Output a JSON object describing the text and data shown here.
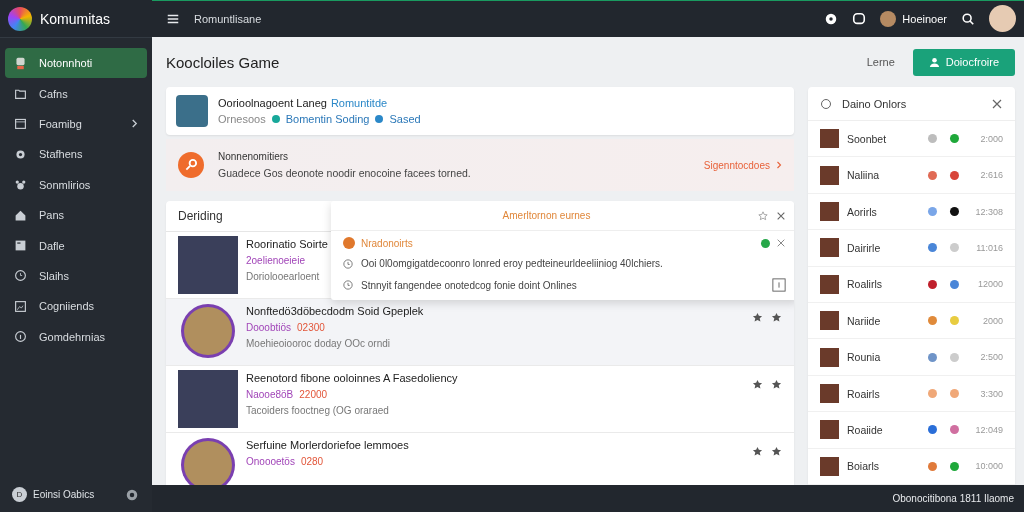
{
  "app": {
    "name": "Komumitas"
  },
  "topbar": {
    "title": "Romuntlisane",
    "user_name": "Hoeinoer"
  },
  "sidebar": {
    "items": [
      {
        "label": "Notonnhoti",
        "selected": true,
        "submenu": false
      },
      {
        "label": "Cafns",
        "selected": false,
        "submenu": false
      },
      {
        "label": "Foamibg",
        "selected": false,
        "submenu": true
      },
      {
        "label": "Stafhens",
        "selected": false,
        "submenu": false
      },
      {
        "label": "Sonmlirios",
        "selected": false,
        "submenu": false
      },
      {
        "label": "Pans",
        "selected": false,
        "submenu": false
      },
      {
        "label": "Dafle",
        "selected": false,
        "submenu": false
      },
      {
        "label": "Slaihs",
        "selected": false,
        "submenu": false
      },
      {
        "label": "Cogniiends",
        "selected": false,
        "submenu": false
      },
      {
        "label": "Gomdehrnias",
        "selected": false,
        "submenu": false
      }
    ],
    "footer": {
      "initial": "D",
      "label": "Eoinsi Oabics"
    }
  },
  "page": {
    "title": "Koocloiles Game",
    "secondary_button": "Lerne",
    "primary_button": "Doiocfroire"
  },
  "profile_card": {
    "name": "Oorioolnagoent Laneg",
    "link": "Romuntitde",
    "status": "Ornesoos",
    "tag_1": "Bomentin Soding",
    "tag_2": "Sased"
  },
  "notice": {
    "title": "Nonnenomitiers",
    "text": "Guadece  Gos deonote noodir enocoine facees torned.",
    "link": "Sigenntocdoes"
  },
  "feed": {
    "title": "Deriding",
    "items": [
      {
        "title": "Roorinatio Soirte",
        "tag": "2oelienoeieie",
        "sub": "Doriolooearloent",
        "selected": false
      },
      {
        "title": "Nonftedö3döbecdodm Soid Gpeplek",
        "tag": "Dooobtiös",
        "price": "02300",
        "sub": "Moehieoiooroc doday  OOc orndi",
        "selected": true
      },
      {
        "title": "Reenotord fibone ooloinnes A Fasedoliency",
        "tag": "Naooe8öB",
        "price": "22000",
        "sub": "Tacoiders fooctneg (OG oraraed",
        "selected": false
      },
      {
        "title": "Serfuine Morlerdoriefoe lemmoes",
        "tag": "Onoooetös",
        "price": "0280",
        "selected": false
      }
    ]
  },
  "popup": {
    "title": "Amerltornon eurnes",
    "heading": "Nradonoirts",
    "lines": [
      "Ooi 0l0omgigatdecoonro lonred eroy pedteineurldeeliiniog 40lchiers.",
      "Stnnyit fangendee onotedcog  fonie doint Onlines"
    ]
  },
  "online": {
    "title": "Daino Onlors",
    "items": [
      {
        "name": "Soonbet",
        "time": "2:000",
        "dots": [
          {
            "color": "#bdbdbd"
          },
          {
            "color": "#1fa83a"
          }
        ]
      },
      {
        "name": "Naliina",
        "time": "2:616",
        "dots": [
          {
            "color": "#e06a55"
          },
          {
            "color": "#d8453a"
          }
        ]
      },
      {
        "name": "Aorirls",
        "time": "12:308",
        "dots": [
          {
            "color": "#7aa6e8"
          },
          {
            "color": "#111111"
          }
        ]
      },
      {
        "name": "Dairirle",
        "time": "11:016",
        "dots": [
          {
            "color": "#4a86d8"
          },
          {
            "color": "#cccccc"
          }
        ]
      },
      {
        "name": "Roalirls",
        "time": "12000",
        "dots": [
          {
            "color": "#c0202c"
          },
          {
            "color": "#4a86d8"
          }
        ]
      },
      {
        "name": "Nariide",
        "time": "2000",
        "dots": [
          {
            "color": "#e08a3a"
          },
          {
            "color": "#e8cc40"
          }
        ]
      },
      {
        "name": "Rounia",
        "time": "2:500",
        "dots": [
          {
            "color": "#6f94c8"
          },
          {
            "color": "#cccccc"
          }
        ]
      },
      {
        "name": "Roairls",
        "time": "3:300",
        "dots": [
          {
            "color": "#f0a878"
          },
          {
            "color": "#f0a878"
          }
        ]
      },
      {
        "name": "Roaiide",
        "time": "12:049",
        "dots": [
          {
            "color": "#2a6ed8"
          },
          {
            "color": "#d06fa0"
          }
        ]
      },
      {
        "name": "Boiarls",
        "time": "10:000",
        "dots": [
          {
            "color": "#e07a3a"
          },
          {
            "color": "#1fa83a"
          }
        ]
      }
    ]
  },
  "status_bar": {
    "text": "Obonocitibona 1811  Ilaome"
  }
}
